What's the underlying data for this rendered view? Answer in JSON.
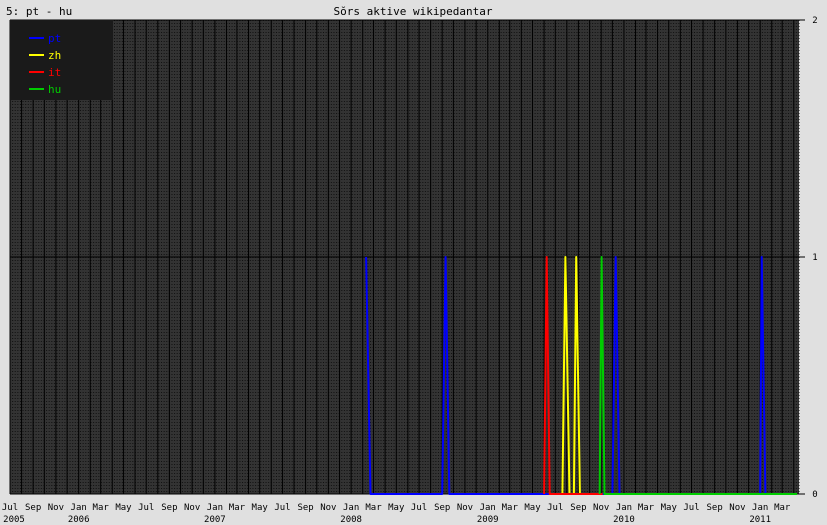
{
  "header": {
    "left_label": "5: pt - hu",
    "title": "Sŏrs aktive wikipedantar"
  },
  "chart_data": {
    "type": "line",
    "title": "Sŏrs aktive wikipedantar",
    "subtitle": "5: pt - hu",
    "xlim": [
      "2005-07-01",
      "2011-04-15"
    ],
    "ylim": [
      0,
      2
    ],
    "y_ticks": [
      0,
      1,
      2
    ],
    "legend": {
      "placement": "top-left",
      "entries": [
        "pt",
        "zh",
        "it",
        "hu"
      ]
    },
    "colors": {
      "pt": "#0000ff",
      "zh": "#ffff00",
      "it": "#ff0000",
      "hu": "#00cc00"
    },
    "background": "#333333",
    "grid": true,
    "x_month_labels": [
      "Jul",
      "Sep",
      "Nov",
      "Jan",
      "Mar",
      "May",
      "Jul",
      "Sep",
      "Nov",
      "Jan",
      "Mar",
      "May",
      "Jul",
      "Sep",
      "Nov",
      "Jan",
      "Mar",
      "May",
      "Jul",
      "Sep",
      "Nov",
      "Jan",
      "Mar",
      "May",
      "Jul",
      "Sep",
      "Nov",
      "Jan",
      "Mar",
      "May",
      "Jul",
      "Sep",
      "Nov",
      "Jan",
      "Mar"
    ],
    "x_year_labels": [
      "2005",
      "2006",
      "2007",
      "2008",
      "2009",
      "2010",
      "2011"
    ],
    "series": [
      {
        "name": "pt",
        "points": [
          [
            "2008-02-10",
            1
          ],
          [
            "2008-02-22",
            0
          ],
          [
            "2008-09-01",
            0
          ],
          [
            "2008-09-10",
            1
          ],
          [
            "2008-09-20",
            0
          ],
          [
            "2009-12-01",
            0
          ],
          [
            "2009-12-10",
            1
          ],
          [
            "2009-12-20",
            0
          ],
          [
            "2011-01-01",
            0
          ],
          [
            "2011-01-05",
            1
          ],
          [
            "2011-01-15",
            0
          ]
        ]
      },
      {
        "name": "zh",
        "points": [
          [
            "2009-07-20",
            0
          ],
          [
            "2009-07-28",
            1
          ],
          [
            "2009-08-08",
            0
          ],
          [
            "2009-08-20",
            0
          ],
          [
            "2009-08-26",
            1
          ],
          [
            "2009-09-05",
            0
          ],
          [
            "2009-10-31",
            0
          ]
        ]
      },
      {
        "name": "it",
        "points": [
          [
            "2009-06-01",
            0
          ],
          [
            "2009-06-08",
            1
          ],
          [
            "2009-06-16",
            0
          ],
          [
            "2009-11-05",
            0
          ]
        ]
      },
      {
        "name": "hu",
        "points": [
          [
            "2009-10-28",
            0
          ],
          [
            "2009-11-02",
            1
          ],
          [
            "2009-11-10",
            0
          ],
          [
            "2011-04-10",
            0
          ]
        ]
      }
    ]
  }
}
